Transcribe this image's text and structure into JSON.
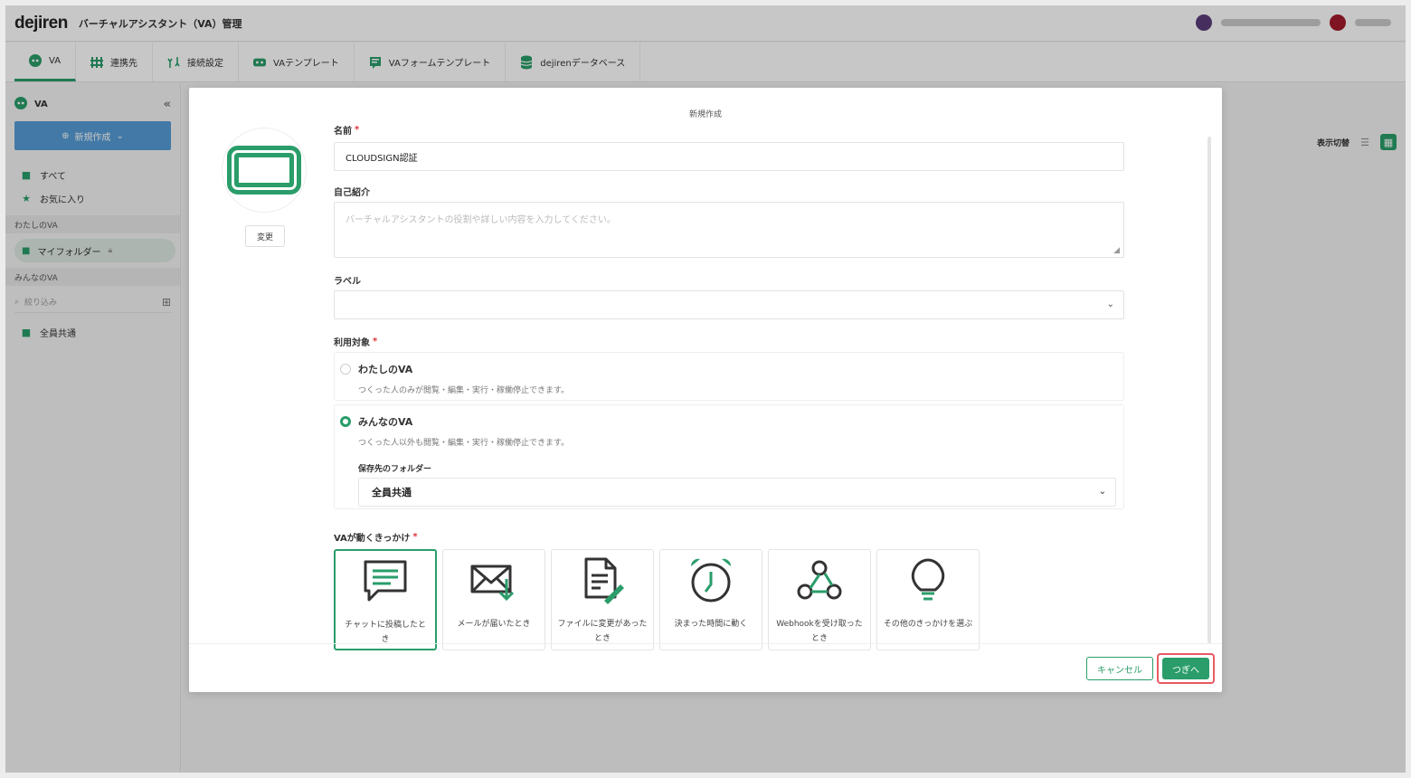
{
  "header": {
    "logo": "dejiren",
    "app_title": "バーチャルアシスタント（VA）管理"
  },
  "nav": {
    "tabs": [
      {
        "label": "VA"
      },
      {
        "label": "連携先"
      },
      {
        "label": "接続設定"
      },
      {
        "label": "VAテンプレート"
      },
      {
        "label": "VAフォームテンプレート"
      },
      {
        "label": "dejirenデータベース"
      }
    ]
  },
  "sidebar": {
    "title": "VA",
    "new_button": "新規作成",
    "items": [
      {
        "label": "すべて"
      },
      {
        "label": "お気に入り"
      }
    ],
    "section_mine": "わたしのVA",
    "my_folder": "マイフォルダー",
    "section_everyone": "みんなのVA",
    "filter_placeholder": "絞り込み",
    "shared_folder": "全員共通"
  },
  "main": {
    "view_toggle_label": "表示切替"
  },
  "modal": {
    "title": "新規作成",
    "change_button": "変更",
    "name_label": "名前",
    "name_value": "CLOUDSIGN認証",
    "intro_label": "自己紹介",
    "intro_placeholder": "バーチャルアシスタントの役割や詳しい内容を入力してください。",
    "label_label": "ラベル",
    "target_label": "利用対象",
    "option_mine_title": "わたしのVA",
    "option_mine_desc": "つくった人のみが閲覧・編集・実行・稼働停止できます。",
    "option_all_title": "みんなのVA",
    "option_all_desc": "つくった人以外も閲覧・編集・実行・稼働停止できます。",
    "folder_label": "保存先のフォルダー",
    "folder_value": "全員共通",
    "trigger_label": "VAが動くきっかけ",
    "triggers": [
      {
        "label": "チャットに投稿したとき",
        "icon": "chat-icon"
      },
      {
        "label": "メールが届いたとき",
        "icon": "mail-icon"
      },
      {
        "label": "ファイルに変更があったとき",
        "icon": "file-edit-icon"
      },
      {
        "label": "決まった時間に動く",
        "icon": "alarm-clock-icon"
      },
      {
        "label": "Webhookを受け取ったとき",
        "icon": "webhook-icon"
      },
      {
        "label": "その他のきっかけを選ぶ",
        "icon": "lightbulb-icon"
      }
    ],
    "cancel_button": "キャンセル",
    "next_button": "つぎへ"
  },
  "colors": {
    "accent": "#2a9d6a",
    "highlight": "#e85a64"
  }
}
